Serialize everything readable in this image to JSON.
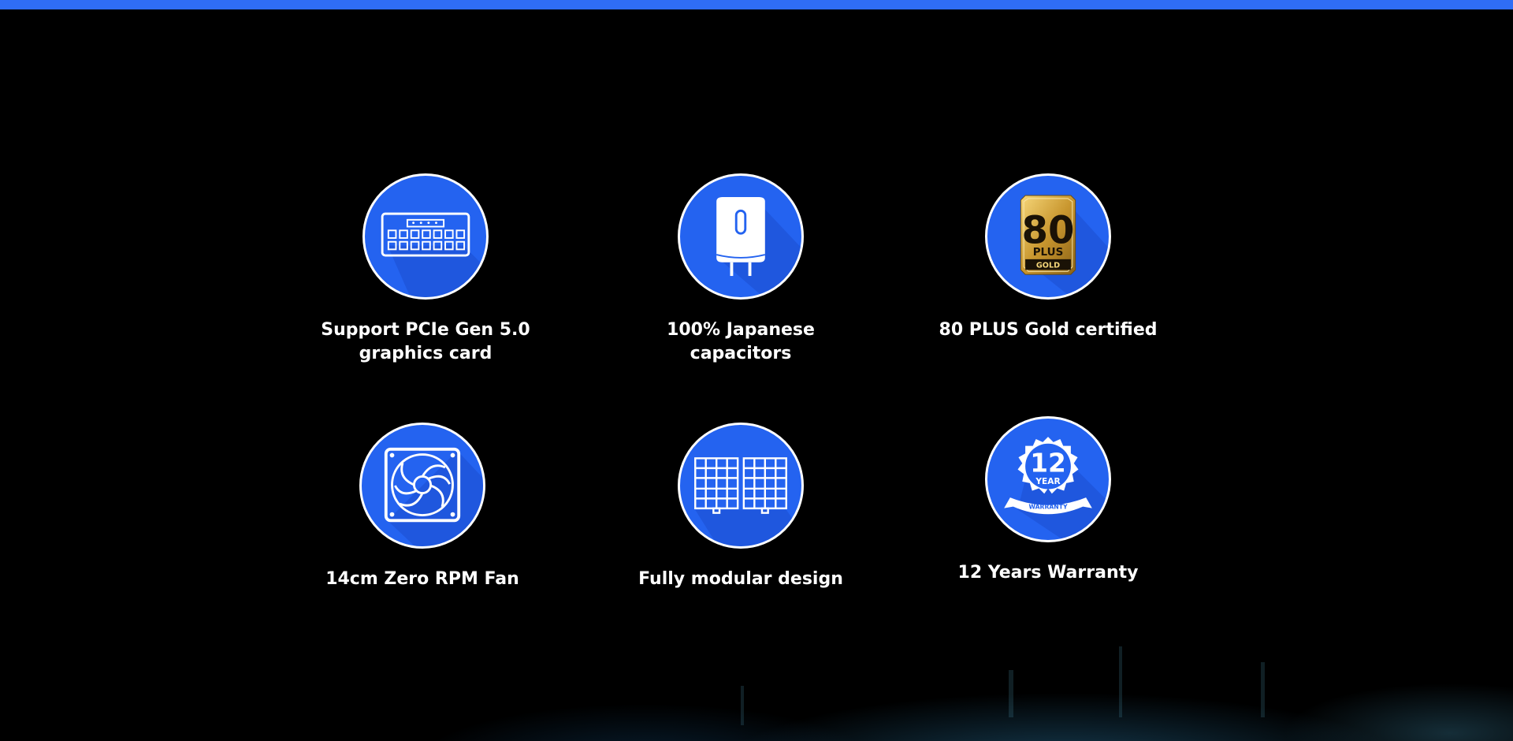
{
  "accent_color": "#2f6df5",
  "badge_color": "#2463f0",
  "features": [
    {
      "icon": "pcie-connector-icon",
      "label": "Support PCIe Gen 5.0\ngraphics card"
    },
    {
      "icon": "capacitor-icon",
      "label": "100% Japanese capacitors"
    },
    {
      "icon": "80-plus-gold-icon",
      "label": "80 PLUS Gold certified",
      "badge_text": {
        "number": "80",
        "plus": "PLUS",
        "tier": "GOLD"
      }
    },
    {
      "icon": "fan-icon",
      "label": "14cm Zero RPM Fan"
    },
    {
      "icon": "modular-cables-icon",
      "label": "Fully modular design"
    },
    {
      "icon": "warranty-seal-icon",
      "label": "12 Years Warranty",
      "badge_text": {
        "number": "12",
        "unit": "YEAR",
        "ribbon": "WARRANTY"
      }
    }
  ]
}
